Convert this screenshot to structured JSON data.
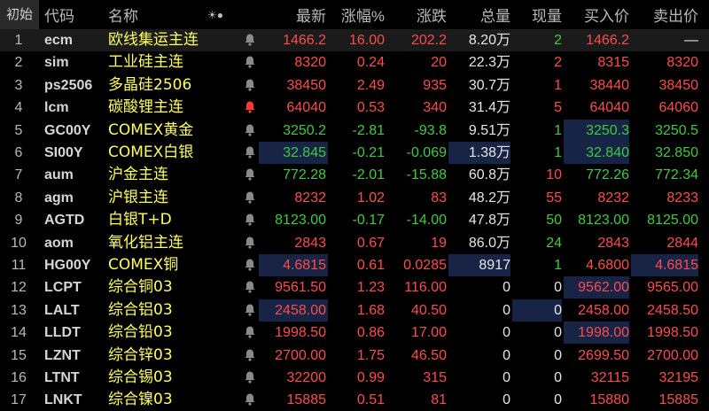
{
  "colors": {
    "up": "#ff4b4b",
    "down": "#3ecb3e",
    "neutral": "#e6e6e6",
    "name": "#ffff5e",
    "highlight_bg": "#182445"
  },
  "header": {
    "index": "初始",
    "code": "代码",
    "name": "名称",
    "star_icon": "☀●",
    "last": "最新",
    "pct": "涨幅%",
    "chg": "涨跌",
    "vol": "总量",
    "cur": "现量",
    "bid": "买入价",
    "ask": "卖出价"
  },
  "rows": [
    {
      "idx": "1",
      "code": "ecm",
      "name": "欧线集运主连",
      "bell": "gray",
      "last": "1466.2",
      "pct": "16.00",
      "chg": "202.2",
      "vol": "8.20万",
      "cur": "2",
      "bid": "1466.2",
      "ask": "—",
      "dir": "up"
    },
    {
      "idx": "2",
      "code": "sim",
      "name": "工业硅主连",
      "bell": "gray",
      "last": "8320",
      "pct": "0.24",
      "chg": "20",
      "vol": "22.3万",
      "cur": "2",
      "bid": "8315",
      "ask": "8320",
      "dir": "up"
    },
    {
      "idx": "3",
      "code": "ps2506",
      "name": "多晶硅2506",
      "bell": "gray",
      "last": "38450",
      "pct": "2.49",
      "chg": "935",
      "vol": "30.7万",
      "cur": "1",
      "bid": "38440",
      "ask": "38450",
      "dir": "up"
    },
    {
      "idx": "4",
      "code": "lcm",
      "name": "碳酸锂主连",
      "bell": "red",
      "last": "64040",
      "pct": "0.53",
      "chg": "340",
      "vol": "31.4万",
      "cur": "5",
      "bid": "64040",
      "ask": "64060",
      "dir": "up"
    },
    {
      "idx": "5",
      "code": "GC00Y",
      "name": "COMEX黄金",
      "bell": "gray",
      "last": "3250.2",
      "pct": "-2.81",
      "chg": "-93.8",
      "vol": "9.51万",
      "cur": "1",
      "bid": "3250.3",
      "ask": "3250.5",
      "dir": "dn"
    },
    {
      "idx": "6",
      "code": "SI00Y",
      "name": "COMEX白银",
      "bell": "gray",
      "last": "32.845",
      "pct": "-0.21",
      "chg": "-0.069",
      "vol": "1.38万",
      "cur": "1",
      "bid": "32.840",
      "ask": "32.850",
      "dir": "dn"
    },
    {
      "idx": "7",
      "code": "aum",
      "name": "沪金主连",
      "bell": "gray",
      "last": "772.28",
      "pct": "-2.01",
      "chg": "-15.88",
      "vol": "60.8万",
      "cur": "10",
      "bid": "772.26",
      "ask": "772.34",
      "dir": "dn"
    },
    {
      "idx": "8",
      "code": "agm",
      "name": "沪银主连",
      "bell": "gray",
      "last": "8232",
      "pct": "1.02",
      "chg": "83",
      "vol": "48.2万",
      "cur": "55",
      "bid": "8232",
      "ask": "8233",
      "dir": "up"
    },
    {
      "idx": "9",
      "code": "AGTD",
      "name": "白银T+D",
      "bell": "gray",
      "last": "8123.00",
      "pct": "-0.17",
      "chg": "-14.00",
      "vol": "47.8万",
      "cur": "50",
      "bid": "8123.00",
      "ask": "8125.00",
      "dir": "dn"
    },
    {
      "idx": "10",
      "code": "aom",
      "name": "氧化铝主连",
      "bell": "gray",
      "last": "2843",
      "pct": "0.67",
      "chg": "19",
      "vol": "86.0万",
      "cur": "24",
      "bid": "2843",
      "ask": "2844",
      "dir": "up"
    },
    {
      "idx": "11",
      "code": "HG00Y",
      "name": "COMEX铜",
      "bell": "gray",
      "last": "4.6815",
      "pct": "0.61",
      "chg": "0.0285",
      "vol": "8917",
      "cur": "1",
      "bid": "4.6800",
      "ask": "4.6815",
      "dir": "up"
    },
    {
      "idx": "12",
      "code": "LCPT",
      "name": "综合铜03",
      "bell": "gray",
      "last": "9561.50",
      "pct": "1.23",
      "chg": "116.00",
      "vol": "0",
      "cur": "0",
      "bid": "9562.00",
      "ask": "9565.00",
      "dir": "up"
    },
    {
      "idx": "13",
      "code": "LALT",
      "name": "综合铝03",
      "bell": "gray",
      "last": "2458.00",
      "pct": "1.68",
      "chg": "40.50",
      "vol": "0",
      "cur": "0",
      "bid": "2458.00",
      "ask": "2458.50",
      "dir": "up"
    },
    {
      "idx": "14",
      "code": "LLDT",
      "name": "综合铅03",
      "bell": "gray",
      "last": "1998.50",
      "pct": "0.86",
      "chg": "17.00",
      "vol": "0",
      "cur": "0",
      "bid": "1998.00",
      "ask": "1998.50",
      "dir": "up"
    },
    {
      "idx": "15",
      "code": "LZNT",
      "name": "综合锌03",
      "bell": "gray",
      "last": "2700.00",
      "pct": "1.75",
      "chg": "46.50",
      "vol": "0",
      "cur": "0",
      "bid": "2699.50",
      "ask": "2700.00",
      "dir": "up"
    },
    {
      "idx": "16",
      "code": "LTNT",
      "name": "综合锡03",
      "bell": "gray",
      "last": "32200",
      "pct": "0.99",
      "chg": "315",
      "vol": "0",
      "cur": "0",
      "bid": "32115",
      "ask": "32195",
      "dir": "up"
    },
    {
      "idx": "17",
      "code": "LNKT",
      "name": "综合镍03",
      "bell": "gray",
      "last": "15885",
      "pct": "0.51",
      "chg": "81",
      "vol": "0",
      "cur": "0",
      "bid": "15880",
      "ask": "15885",
      "dir": "up"
    }
  ]
}
